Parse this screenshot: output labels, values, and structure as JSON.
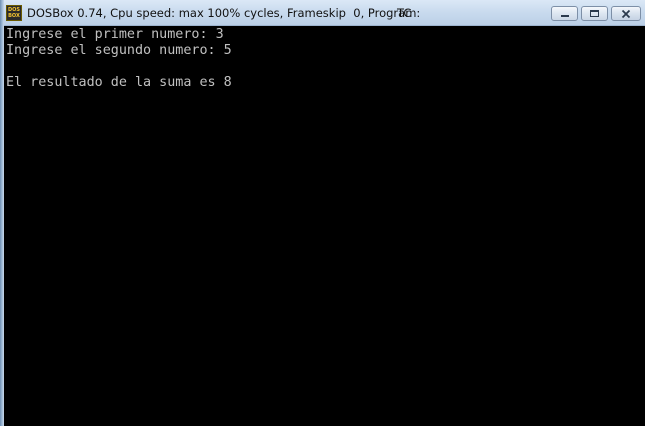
{
  "window": {
    "title": "DOSBox 0.74, Cpu speed: max 100% cycles, Frameskip  0, Program:",
    "program": "TC",
    "icon_text_top": "DOS",
    "icon_text_bottom": "BOX"
  },
  "console": {
    "lines": [
      "Ingrese el primer numero: 3",
      "Ingrese el segundo numero: 5",
      "",
      "El resultado de la suma es 8"
    ]
  },
  "icons": {
    "app": "dosbox-icon",
    "minimize": "minimize-icon",
    "maximize": "maximize-icon",
    "close": "close-icon"
  },
  "colors": {
    "console_background": "#000000",
    "console_text": "#c0c0c0",
    "titlebar": "#c8daee"
  }
}
